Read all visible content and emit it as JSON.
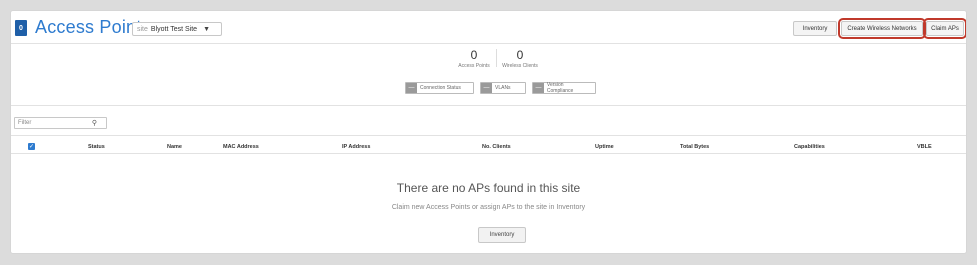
{
  "header": {
    "count_badge": "0",
    "title": "Access Points",
    "site": {
      "prefix": "site",
      "value": "Blyott Test Site"
    },
    "buttons": {
      "inventory": "Inventory",
      "create_wireless": "Create Wireless Networks",
      "claim": "Claim APs"
    }
  },
  "stats": [
    {
      "value": "0",
      "label": "Access Points"
    },
    {
      "value": "0",
      "label": "Wireless Clients"
    }
  ],
  "toggles": [
    {
      "symbol": "—",
      "label": "Connection Status"
    },
    {
      "symbol": "—",
      "label": "VLANs"
    },
    {
      "symbol": "—",
      "label": "Version Compliance"
    }
  ],
  "filter": {
    "placeholder": "Filter"
  },
  "table": {
    "columns": [
      "Status",
      "Name",
      "MAC Address",
      "IP Address",
      "No. Clients",
      "Uptime",
      "Total Bytes",
      "Capabilities",
      "VBLE"
    ]
  },
  "empty_state": {
    "title": "There are no APs found in this site",
    "subtitle": "Claim new Access Points or assign APs to the site in Inventory",
    "button": "Inventory"
  },
  "colors": {
    "accent": "#2e7bcf",
    "highlight": "#c0392b"
  }
}
